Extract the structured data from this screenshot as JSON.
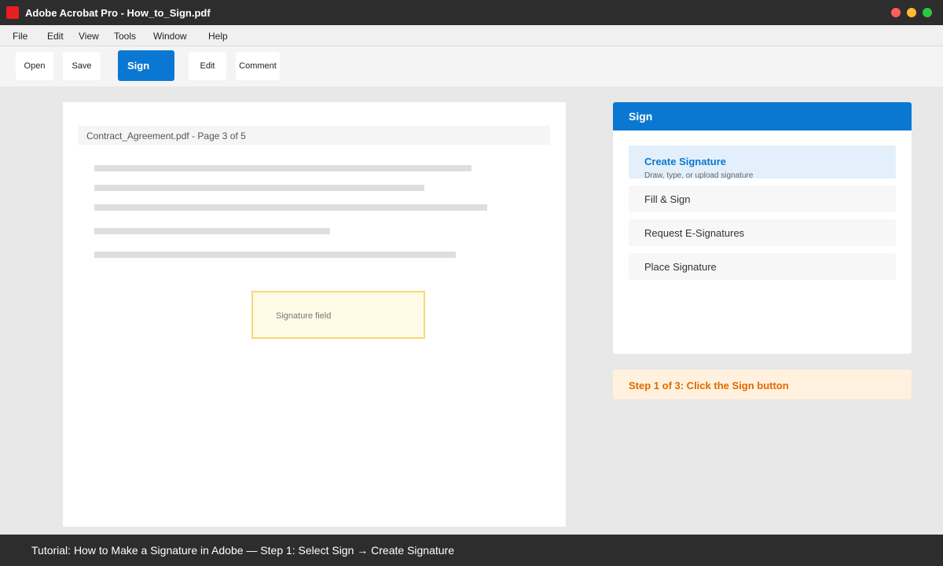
{
  "window": {
    "title": "Adobe Acrobat Pro - How_to_Sign.pdf",
    "app_icon": "acrobat-icon",
    "controls": [
      "close",
      "minimize",
      "zoom"
    ]
  },
  "menubar": {
    "items": [
      "File",
      "Edit",
      "View",
      "Tools",
      "Window",
      "Help"
    ]
  },
  "toolbar": {
    "open_label": "Open",
    "save_label": "Save",
    "sign_label": "Sign",
    "edit_label": "Edit",
    "comment_label": "Comment",
    "active": "Sign"
  },
  "document": {
    "header": "Contract_Agreement.pdf - Page 3 of 5",
    "signature_field_label": "Signature field"
  },
  "sign_panel": {
    "title": "Sign",
    "options": [
      {
        "label": "Create Signature",
        "description": "Draw, type, or upload signature",
        "active": true
      },
      {
        "label": "Fill & Sign"
      },
      {
        "label": "Request E-Signatures"
      },
      {
        "label": "Place Signature"
      }
    ]
  },
  "step_hint": "Step 1 of 3: Click the Sign button",
  "tutorial_caption": "Tutorial: How to Make a Signature in Adobe — Step 1: Select Sign → Create Signature",
  "colors": {
    "accent": "#0a78d2",
    "titlebar": "#2d2d2d",
    "step_text": "#e06a00",
    "step_bg": "#fff1de",
    "signature_field_bg": "#fffbe6",
    "signature_field_border": "#f5d878"
  }
}
